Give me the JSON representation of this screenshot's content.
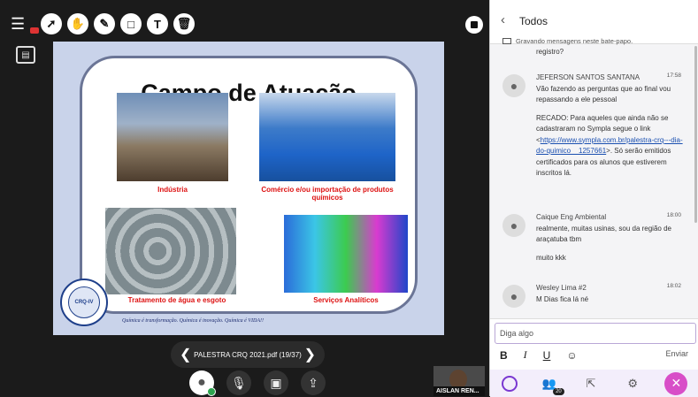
{
  "slide": {
    "title": "Campo de Atuação",
    "captions": {
      "industria": "Indústria",
      "comercio": "Comércio e/ou importação de produtos químicos",
      "tratamento": "Tratamento de água e esgoto",
      "servicos": "Serviços Analíticos"
    },
    "seal_text": "CRQ-IV",
    "motto": "Química é transformação. Química é inovação. Química é VIDA!!"
  },
  "pager": {
    "label": "PALESTRA CRQ 2021.pdf",
    "page": "(19/37)"
  },
  "camera": {
    "name": "AISLAN REN..."
  },
  "chat": {
    "header": "Todos",
    "recording_note": "Gravando mensagens neste bate-papo.",
    "cut_text": "registro?",
    "messages": [
      {
        "author": "JEFERSON SANTOS SANTANA",
        "time": "17:58",
        "line1": "Vão fazendo as perguntas que ao final vou repassando a ele pessoal",
        "line2a": "RECADO: Para aqueles que ainda não se cadastraram no Sympla segue o link <",
        "link": "https://www.sympla.com.br/palestra-crq---dia-do-quimico__1257661",
        "line2b": ">. Só serão emitidos certificados para os alunos que estiverem inscritos lá."
      },
      {
        "author": "Caique Eng Ambiental",
        "time": "18:00",
        "line1": "realmente, muitas usinas, sou da região de araçatuba tbm",
        "line2": "muito kkk"
      },
      {
        "author": "Wesley Lima #2",
        "time": "18:02",
        "line1": "M Dias fica lá né"
      }
    ],
    "input_placeholder": "Diga algo",
    "format": {
      "bold": "B",
      "italic": "I",
      "underline": "U"
    },
    "send_label": "Enviar",
    "participants_count": "20"
  }
}
